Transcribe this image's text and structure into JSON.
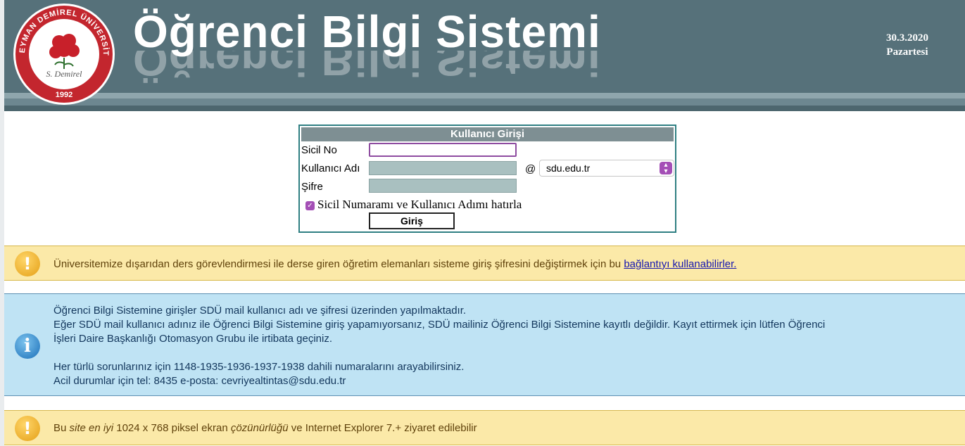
{
  "header": {
    "title": "Öğrenci Bilgi Sistemi",
    "date": "30.3.2020",
    "weekday": "Pazartesi",
    "logo": {
      "icon": "rose-emblem-icon",
      "top_text": "SÜLEYMAN DEMİREL ÜNİVERSİTESİ",
      "signature": "S. Demirel",
      "year": "1992"
    }
  },
  "login": {
    "title": "Kullanıcı Girişi",
    "sicil_label": "Sicil No",
    "sicil_value": "",
    "username_label": "Kullanıcı Adı",
    "username_value": "",
    "at_sign": "@",
    "domain_selected": "sdu.edu.tr",
    "password_label": "Şifre",
    "password_value": "",
    "remember_label": "Sicil Numaramı ve Kullanıcı Adımı hatırla",
    "remember_checked": true,
    "submit_label": "Giriş"
  },
  "notice1": {
    "text": "Üniversitemize dışarıdan ders görevlendirmesi ile derse giren öğretim elemanları sisteme giriş şifresini değiştirmek için bu",
    "link": "bağlantıyı kullanabilirler."
  },
  "notice2": {
    "line1": "Öğrenci Bilgi Sistemine girişler SDÜ mail kullanıcı adı ve şifresi üzerinden yapılmaktadır.",
    "line2": "Eğer SDÜ mail kullanıcı adınız ile Öğrenci Bilgi Sistemine giriş yapamıyorsanız, SDÜ mailiniz Öğrenci Bilgi Sistemine kayıtlı değildir. Kayıt ettirmek için lütfen Öğrenci",
    "line3": "İşleri Daire Başkanlığı Otomasyon Grubu ile irtibata geçiniz.",
    "line4": "Her türlü sorunlarınız için 1148-1935-1936-1937-1938 dahili numaralarını arayabilirsiniz.",
    "line5": "Acil durumlar için tel: 8435 e-posta: cevriyealtintas@sdu.edu.tr"
  },
  "notice3": {
    "prefix": "Bu",
    "em1": "site en iyi",
    "mid": "1024 x 768 piksel ekran",
    "em2": "çözünürlüğü",
    "suffix": "ve Internet Explorer 7.+ ziyaret edilebilir"
  },
  "colors": {
    "header_bg": "#56717a",
    "panel_border": "#2f7f82",
    "warn_bg": "#fbe9a8",
    "info_bg": "#bfe3f4",
    "accent": "#a44fb6"
  }
}
